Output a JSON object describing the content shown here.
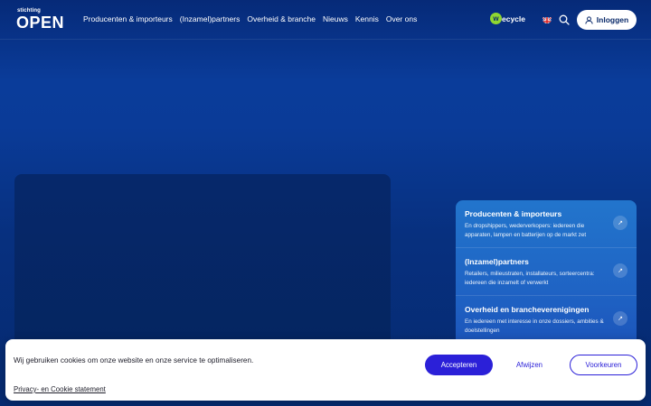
{
  "header": {
    "logo_small": "stichting",
    "logo_big": "OPEN",
    "nav": [
      {
        "label": "Producenten & importeurs"
      },
      {
        "label": "(Inzamel)partners"
      },
      {
        "label": "Overheid & branche"
      },
      {
        "label": "Nieuws"
      },
      {
        "label": "Kennis"
      },
      {
        "label": "Over ons"
      }
    ],
    "wecycle_mark": "w",
    "wecycle_text": "ecycle",
    "language_icon": "uk-flag-icon",
    "search_icon": "search-icon",
    "login_label": "Inloggen"
  },
  "cards": [
    {
      "title": "Producenten & importeurs",
      "desc": "En dropshippers, wederverkopers: iedereen die apparaten, lampen en batterijen op de markt zet"
    },
    {
      "title": "(Inzamel)partners",
      "desc": "Retailers, milieustraten, installateurs, sorteercentra: iedereen die inzamelt of verwerkt"
    },
    {
      "title": "Overheid en brancheverenigingen",
      "desc": "En iedereen met interesse in onze dossiers, ambities & doelstellingen"
    }
  ],
  "cookie": {
    "message": "Wij gebruiken cookies om onze website en onze service te optimaliseren.",
    "accept_label": "Accepteren",
    "reject_label": "Afwijzen",
    "prefs_label": "Voorkeuren",
    "policy_link": "Privacy- en Cookie statement"
  },
  "colors": {
    "brand_blue": "#062a78",
    "accent_button": "#2b20d8",
    "wecycle_green": "#8fd630"
  }
}
